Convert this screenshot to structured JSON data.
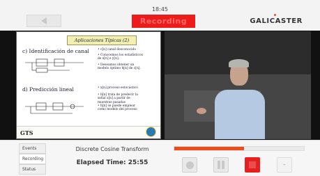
{
  "header": {
    "clock": "18:45",
    "recording_label": "Recording",
    "logo_text": "GALICASTER"
  },
  "slide": {
    "title": "Aplicaciones Típicas (2)",
    "section_c": "c) Identificación de canal",
    "section_d": "d) Predicción lineal",
    "bullets_c": [
      "• c[n] canal desconocido",
      "• Conocemos los estadísticos de x[n] e y[n].",
      "• Deseamos obtener un modelo óptimo h[n] de c[n]."
    ],
    "bullets_d": [
      "• x[n] proceso estocástico",
      "• h[n] trata de predecir la señal x[n] a partir de muestras pasadas",
      "• h[n] se puede emplear como modelo del proceso"
    ],
    "footer_logo": "GTS"
  },
  "bottom_panel": {
    "tabs": [
      {
        "label": "Events"
      },
      {
        "label": "Recording"
      },
      {
        "label": "Status"
      }
    ],
    "media_title": "Discrete Cosine Transform",
    "elapsed": "Elapsed Time: 25:55",
    "progress_fraction": 0.54,
    "controls": [
      {
        "name": "record-button",
        "icon": "record-icon"
      },
      {
        "name": "pause-button",
        "icon": "pause-icon"
      },
      {
        "name": "stop-button",
        "icon": "stop-icon"
      },
      {
        "name": "camera-control-button",
        "icon": "camera-icon"
      }
    ]
  }
}
